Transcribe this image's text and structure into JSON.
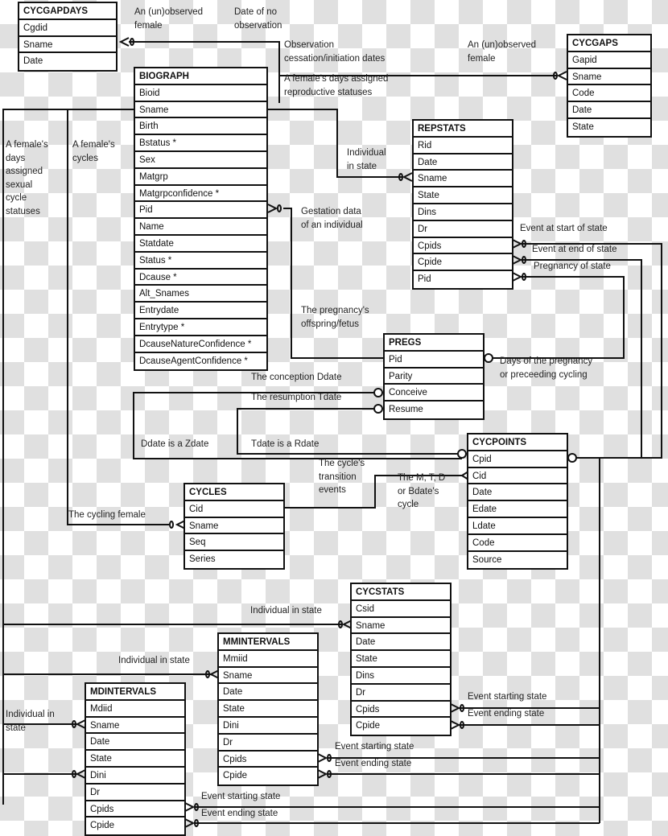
{
  "entities": {
    "cycgapdays": {
      "title": "CYCGAPDAYS",
      "fields": [
        "Cgdid",
        "Sname",
        "Date"
      ]
    },
    "biograph": {
      "title": "BIOGRAPH",
      "fields": [
        "Bioid",
        "Sname",
        "Birth",
        "Bstatus *",
        "Sex",
        "Matgrp",
        "Matgrpconfidence *",
        "Pid",
        "Name",
        "Statdate",
        "Status *",
        "Dcause *",
        "Alt_Snames",
        "Entrydate",
        "Entrytype *",
        "DcauseNatureConfidence *",
        "DcauseAgentConfidence *"
      ]
    },
    "cycgaps": {
      "title": "CYCGAPS",
      "fields": [
        "Gapid",
        "Sname",
        "Code",
        "Date",
        "State"
      ]
    },
    "repstats": {
      "title": "REPSTATS",
      "fields": [
        "Rid",
        "Date",
        "Sname",
        "State",
        "Dins",
        "Dr",
        "Cpids",
        "Cpide",
        "Pid"
      ]
    },
    "pregs": {
      "title": "PREGS",
      "fields": [
        "Pid",
        "Parity",
        "Conceive",
        "Resume"
      ]
    },
    "cycpoints": {
      "title": "CYCPOINTS",
      "fields": [
        "Cpid",
        "Cid",
        "Date",
        "Edate",
        "Ldate",
        "Code",
        "Source"
      ]
    },
    "cycles": {
      "title": "CYCLES",
      "fields": [
        "Cid",
        "Sname",
        "Seq",
        "Series"
      ]
    },
    "cycstats": {
      "title": "CYCSTATS",
      "fields": [
        "Csid",
        "Sname",
        "Date",
        "State",
        "Dins",
        "Dr",
        "Cpids",
        "Cpide"
      ]
    },
    "mmintervals": {
      "title": "MMINTERVALS",
      "fields": [
        "Mmiid",
        "Sname",
        "Date",
        "State",
        "Dini",
        "Dr",
        "Cpids",
        "Cpide"
      ]
    },
    "mdintervals": {
      "title": "MDINTERVALS",
      "fields": [
        "Mdiid",
        "Sname",
        "Date",
        "State",
        "Dini",
        "Dr",
        "Cpids",
        "Cpide"
      ]
    }
  },
  "labels": {
    "unobserved_female_1": "An (un)observed\nfemale",
    "date_no_observation": "Date of no\nobservation",
    "observation_dates": "Observation\ncessation/initiation dates",
    "unobserved_female_2": "An (un)observed\nfemale",
    "repro_statuses": "A female's days assigned\nreproductive statuses",
    "sexual_cycle_statuses": "A female's\ndays\nassigned\nsexual\ncycle\nstatuses",
    "female_cycles": "A female's\ncycles",
    "individual_in_state_rep": "Individual\nin state",
    "gestation_data": "Gestation data\nof an individual",
    "event_start_of_state": "Event at start of state",
    "event_end_of_state": "Event at end of state",
    "pregnancy_of_state": "Pregnancy of state",
    "offspring_fetus": "The pregnancy's\noffspring/fetus",
    "days_of_pregnancy": "Days of the pregnancy\nor preceeding cycling",
    "conception_ddate": "The conception Ddate",
    "resumption_tdate": "The resumption Tdate",
    "ddate_zdate": "Ddate is a Zdate",
    "tdate_rdate": "Tdate is a Rdate",
    "transition_events": "The cycle's\ntransition\nevents",
    "mtd_bdate_cycle": "The M, T, D\nor Bdate's\ncycle",
    "cycling_female": "The cycling female",
    "individual_in_state_cyc": "Individual in state",
    "individual_in_state_mm": "Individual in state",
    "individual_in_state_md": "Individual in\nstate",
    "cyc_event_starting": "Event starting state",
    "cyc_event_ending": "Event ending state",
    "mm_event_starting": "Event starting state",
    "mm_event_ending": "Event ending state",
    "md_event_starting": "Event starting state",
    "md_event_ending": "Event ending state"
  }
}
